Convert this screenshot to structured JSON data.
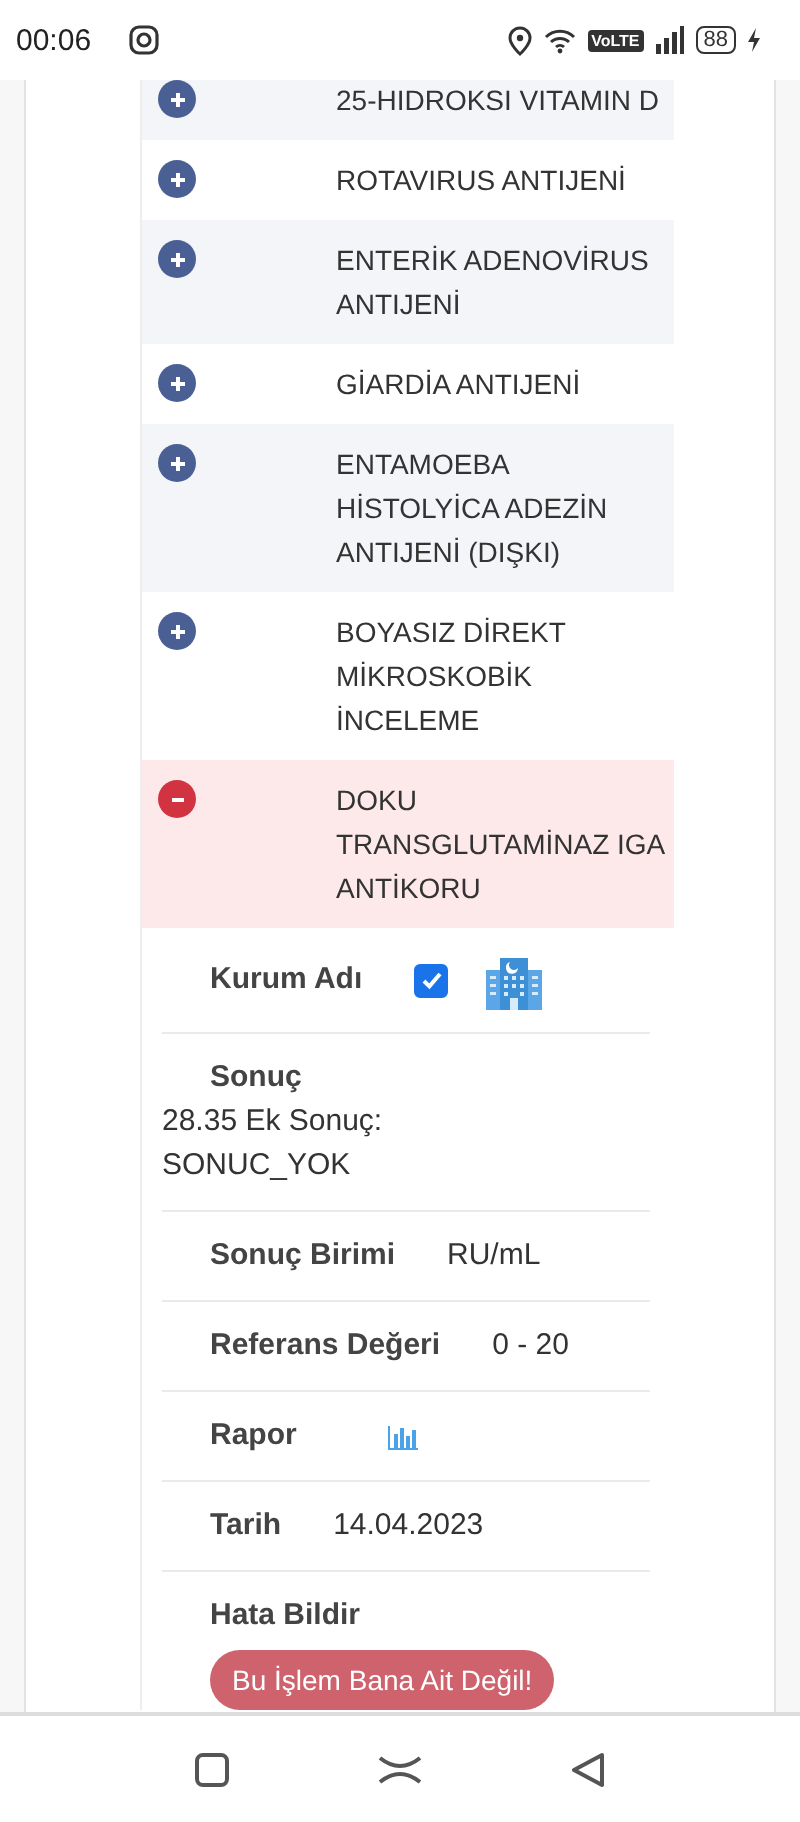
{
  "status_bar": {
    "time": "00:06",
    "network": "VoLTE",
    "battery": "88"
  },
  "tests": [
    {
      "name": "25-HIDROKSI VITAMIN D",
      "expanded": false
    },
    {
      "name": "ROTAVIRUS ANTIJENİ",
      "expanded": false
    },
    {
      "name": "ENTERİK ADENOVİRUS ANTIJENİ",
      "expanded": false
    },
    {
      "name": "GİARDİA ANTIJENİ",
      "expanded": false
    },
    {
      "name": "ENTAMOEBA HİSTOLYİCA ADEZİN ANTIJENİ (DIŞKI)",
      "expanded": false
    },
    {
      "name": "BOYASIZ DİREKT MİKROSKOBİK İNCELEME",
      "expanded": false
    },
    {
      "name": "DOKU TRANSGLUTAMİNAZ IGA ANTİKORU",
      "expanded": true
    }
  ],
  "details": [
    {
      "kind": "checkbox",
      "label": "Kurum Adı",
      "checked": true
    },
    {
      "kind": "text",
      "label": "Sonuç",
      "value": "28.35 Ek Sonuç: SONUC_YOK"
    },
    {
      "kind": "text",
      "label": "Sonuç Birimi",
      "value": "RU/mL"
    },
    {
      "kind": "text",
      "label": "Referans Değeri",
      "value": "0 - 20"
    },
    {
      "kind": "report",
      "label": "Rapor"
    },
    {
      "kind": "text",
      "label": "Tarih",
      "value": "14.04.2023"
    },
    {
      "kind": "button",
      "label": "Hata Bildir",
      "button": "Bu İşlem Bana Ait Değil!"
    }
  ]
}
